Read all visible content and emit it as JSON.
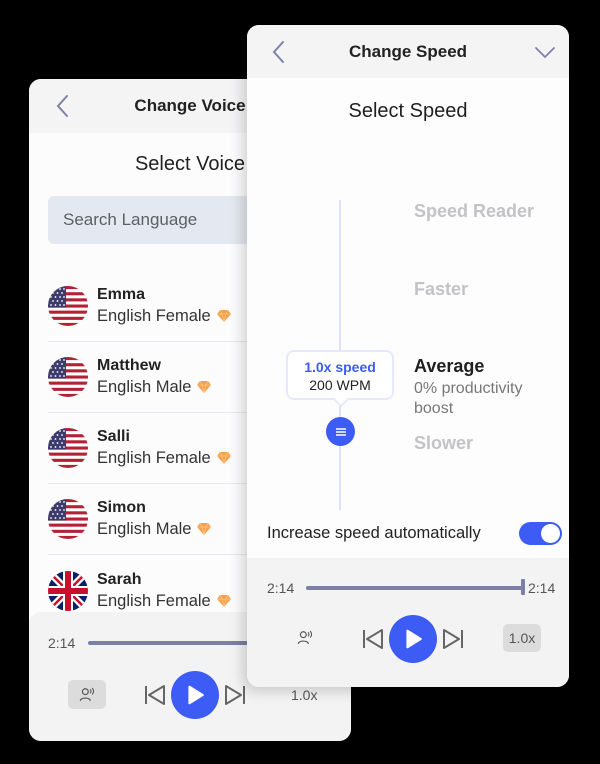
{
  "voice_panel": {
    "header_title": "Change Voice",
    "section_title": "Select Voice",
    "search": {
      "placeholder": "Search Language",
      "value": ""
    },
    "voices": [
      {
        "name": "Emma",
        "description": "English Female",
        "flag": "us-flag",
        "premium": true
      },
      {
        "name": "Matthew",
        "description": "English Male",
        "flag": "us-flag",
        "premium": true
      },
      {
        "name": "Salli",
        "description": "English Female",
        "flag": "us-flag",
        "premium": true
      },
      {
        "name": "Simon",
        "description": "English Male",
        "flag": "us-flag",
        "premium": true
      },
      {
        "name": "Sarah",
        "description": "English Female",
        "flag": "uk-flag",
        "premium": true
      }
    ],
    "player": {
      "time_current": "2:14",
      "speed": "1.0x"
    }
  },
  "speed_panel": {
    "header_title": "Change Speed",
    "section_title": "Select Speed",
    "options": {
      "speed_reader": "Speed Reader",
      "faster": "Faster",
      "average": "Average",
      "average_desc": "0% productivity boost",
      "slower": "Slower"
    },
    "selected_option": "Average",
    "tooltip": {
      "speed": "1.0x speed",
      "wpm": "200 WPM"
    },
    "auto_increase": {
      "label": "Increase speed automatically",
      "enabled": true
    },
    "player": {
      "time_current": "2:14",
      "time_total": "2:14",
      "progress": 1.0,
      "speed": "1.0x"
    }
  },
  "colors": {
    "accent": "#3d5bf5",
    "progress": "#7c7fa6",
    "premium_gem": "#f5a04a"
  },
  "icons": {
    "back": "chevron-left-icon",
    "collapse": "chevron-down-icon",
    "premium": "gem-icon",
    "voice": "voice-icon",
    "prev": "skip-back-icon",
    "play": "play-icon",
    "next": "skip-forward-icon",
    "slider_thumb": "drag-handle-icon"
  }
}
